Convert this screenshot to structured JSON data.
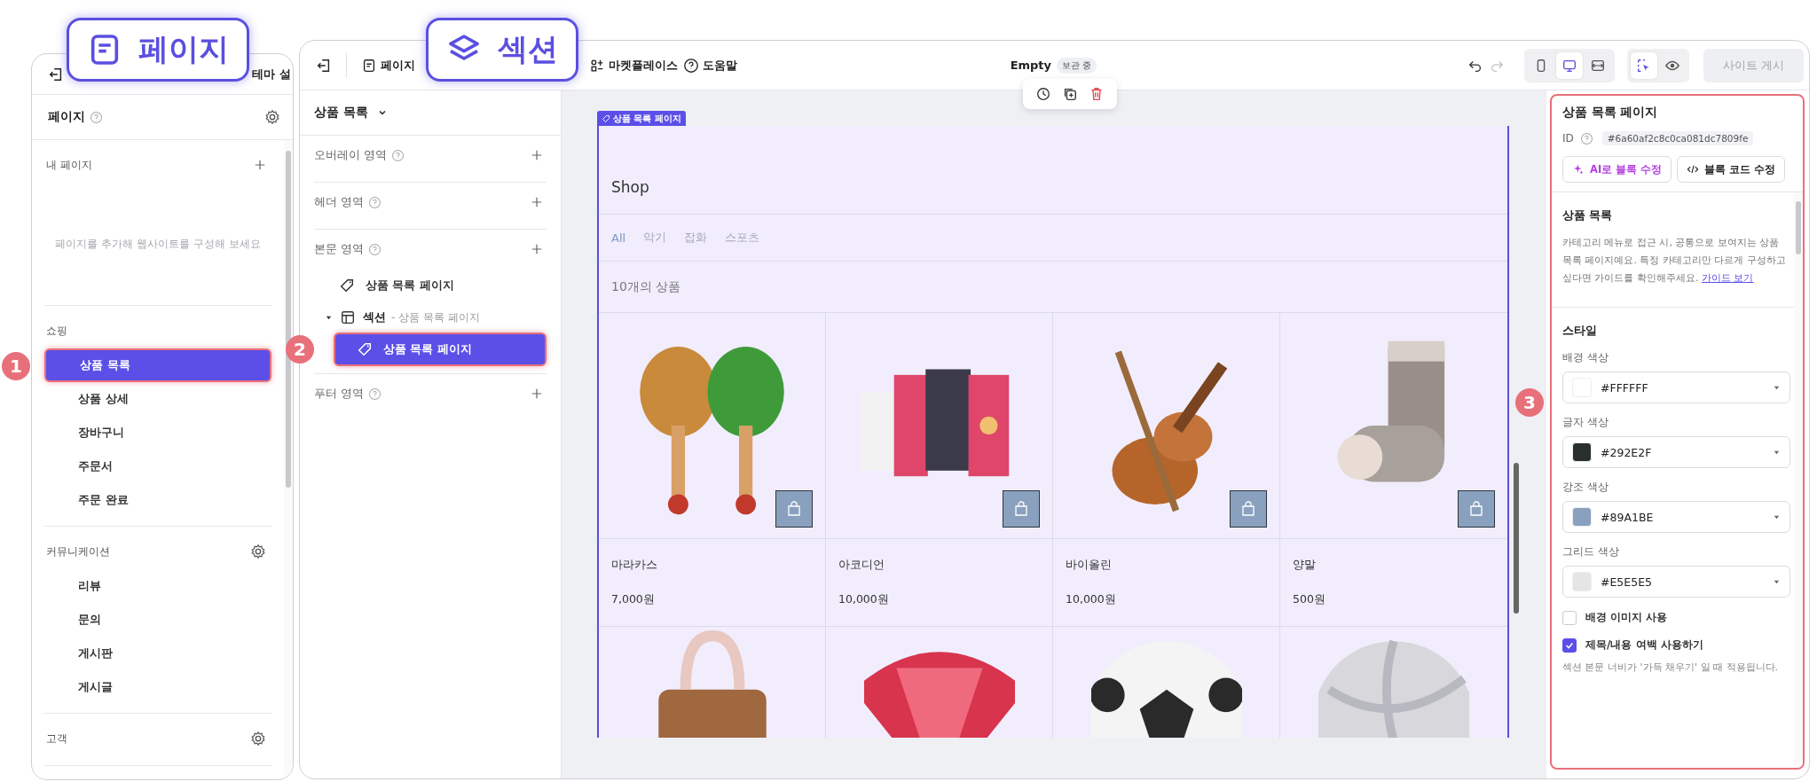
{
  "callouts": [
    {
      "kind": "page",
      "label": "페이지"
    },
    {
      "kind": "section",
      "label": "섹션"
    }
  ],
  "step_markers": [
    "1",
    "2",
    "3"
  ],
  "pages_panel": {
    "tab_partial": "테마 설",
    "title": "페이지",
    "my_pages_label": "내 페이지",
    "empty_message": "페이지를 추가해 웹사이트를 구성해 보세요",
    "groups": [
      {
        "label": "쇼핑",
        "has_settings": false,
        "items": [
          {
            "label": "상품 목록",
            "selected": true
          },
          {
            "label": "상품 상세",
            "selected": false
          },
          {
            "label": "장바구니",
            "selected": false
          },
          {
            "label": "주문서",
            "selected": false
          },
          {
            "label": "주문 완료",
            "selected": false
          }
        ]
      },
      {
        "label": "커뮤니케이션",
        "has_settings": true,
        "items": [
          {
            "label": "리뷰",
            "selected": false
          },
          {
            "label": "문의",
            "selected": false
          },
          {
            "label": "게시판",
            "selected": false
          },
          {
            "label": "게시글",
            "selected": false
          }
        ]
      },
      {
        "label": "고객",
        "has_settings": true
      }
    ]
  },
  "toolbar": {
    "page_button": "페이지",
    "marketplace": "마켓플레이스",
    "help": "도움말",
    "document_title": "Empty",
    "status_badge": "보관 중",
    "redo_enabled": false,
    "devices": [
      {
        "kind": "mobile",
        "selected": false
      },
      {
        "kind": "desktop",
        "selected": true
      },
      {
        "kind": "responsive",
        "selected": false
      }
    ],
    "select_mode": true,
    "publish": {
      "label": "사이트 게시",
      "disabled": true
    }
  },
  "section_panel": {
    "page_select": "상품 목록",
    "areas": [
      {
        "label": "오버레이 영역"
      },
      {
        "label": "헤더 영역"
      },
      {
        "label": "본문 영역",
        "children": [
          {
            "kind": "block",
            "label": "상품 목록 페이지",
            "selected": false
          },
          {
            "kind": "section",
            "label": "섹션",
            "subtitle": "- 상품 목록 페이지",
            "expanded": true,
            "children": [
              {
                "kind": "block",
                "label": "상품 목록 페이지",
                "selected": true
              }
            ]
          }
        ]
      },
      {
        "label": "푸터 영역"
      }
    ]
  },
  "canvas": {
    "block_tag": "상품 목록 페이지",
    "shop_title": "Shop",
    "categories": [
      {
        "label": "All",
        "selected": true
      },
      {
        "label": "악기",
        "selected": false
      },
      {
        "label": "잡화",
        "selected": false
      },
      {
        "label": "스포츠",
        "selected": false
      }
    ],
    "count": "10개의 상품",
    "products": [
      {
        "name": "마라카스",
        "price": "7,000원"
      },
      {
        "name": "아코디언",
        "price": "10,000원"
      },
      {
        "name": "바이올린",
        "price": "10,000원"
      },
      {
        "name": "양말",
        "price": "500원"
      }
    ]
  },
  "inspector": {
    "title": "상품 목록 페이지",
    "id_label": "ID",
    "id_value": "#6a60af2c8c0ca081dc7809fe",
    "ai_button": "AI로 블록 수정",
    "code_button": "블록 코드 수정",
    "section_title": "상품 목록",
    "description": "카테고리 메뉴로 접근 시, 공통으로 보여지는 상품 목록 페이지예요. 특정 카테고리만 다르게 구성하고싶다면 가이드를 확인해주세요.",
    "guide_link": "가이드 보기",
    "style_title": "스타일",
    "colors": [
      {
        "label": "배경 색상",
        "value": "#FFFFFF"
      },
      {
        "label": "글자 색상",
        "value": "#292E2F"
      },
      {
        "label": "강조 색상",
        "value": "#89A1BE"
      },
      {
        "label": "그리드 색상",
        "value": "#E5E5E5"
      }
    ],
    "options": [
      {
        "label": "배경 이미지 사용",
        "checked": false
      },
      {
        "label": "제목/내용 여백 사용하기",
        "checked": true
      }
    ],
    "note": "섹션 본문 너비가 '가득 채우기' 일 때 적용됩니다."
  }
}
